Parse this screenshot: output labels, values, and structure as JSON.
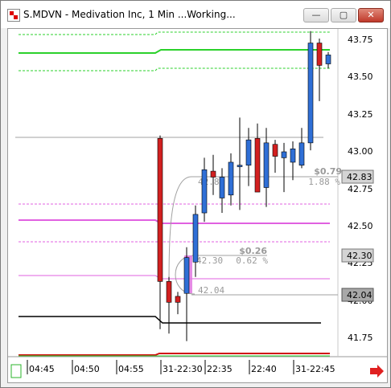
{
  "window": {
    "title": "S.MDVN - Medivation Inc, 1 Min ...Working...",
    "buttons": {
      "minimize": "—",
      "maximize": "▢",
      "close": "✕"
    }
  },
  "price_axis": {
    "ticks": [
      "43.75",
      "43.50",
      "43.25",
      "43.00",
      "42.75",
      "42.50",
      "42.25",
      "42.00",
      "41.75"
    ],
    "markers": [
      {
        "label": "42.83",
        "style": "gray"
      },
      {
        "label": "42.30",
        "style": "gray"
      },
      {
        "label": "42.04",
        "style": "dark"
      }
    ]
  },
  "time_axis": {
    "labels": [
      "04:45",
      "04:50",
      "04:55",
      "31-22:30",
      "22:35",
      "22:40",
      "31-22:45"
    ]
  },
  "annotations": {
    "a1_change": "$0.79",
    "a1_pct": "1.88 %",
    "a1_price": "42.83",
    "a2_change": "$0.26",
    "a2_pct": "0.62 %",
    "a2_price": "42.30",
    "a3_price": "42.04"
  },
  "colors": {
    "up": "#2f6fd6",
    "down": "#d22020",
    "green_line": "#2bd12b",
    "magenta_line": "#e060e0",
    "black_line": "#000000",
    "red_line": "#d01010",
    "scroll_arrow": "#e02020"
  },
  "chart_data": {
    "type": "candlestick",
    "candles": [
      {
        "o": 43.08,
        "h": 43.1,
        "l": 41.8,
        "c": 42.12
      },
      {
        "o": 42.12,
        "h": 42.15,
        "l": 41.77,
        "c": 41.98
      },
      {
        "o": 42.02,
        "h": 42.05,
        "l": 41.9,
        "c": 41.98
      },
      {
        "o": 42.04,
        "h": 42.35,
        "l": 41.72,
        "c": 42.28
      },
      {
        "o": 42.25,
        "h": 42.63,
        "l": 42.15,
        "c": 42.57
      },
      {
        "o": 42.58,
        "h": 42.95,
        "l": 42.52,
        "c": 42.87
      },
      {
        "o": 42.86,
        "h": 42.97,
        "l": 42.7,
        "c": 42.82
      },
      {
        "o": 42.68,
        "h": 42.88,
        "l": 42.58,
        "c": 42.82
      },
      {
        "o": 42.7,
        "h": 42.98,
        "l": 42.63,
        "c": 42.92
      },
      {
        "o": 42.89,
        "h": 43.22,
        "l": 42.6,
        "c": 42.9
      },
      {
        "o": 42.9,
        "h": 43.15,
        "l": 42.76,
        "c": 43.07
      },
      {
        "o": 43.08,
        "h": 43.18,
        "l": 42.75,
        "c": 42.72
      },
      {
        "o": 42.75,
        "h": 43.15,
        "l": 42.62,
        "c": 43.05
      },
      {
        "o": 43.04,
        "h": 43.07,
        "l": 42.85,
        "c": 42.96
      },
      {
        "o": 42.95,
        "h": 43.05,
        "l": 42.72,
        "c": 42.99
      },
      {
        "o": 42.92,
        "h": 43.06,
        "l": 42.8,
        "c": 43.01
      },
      {
        "o": 42.9,
        "h": 43.15,
        "l": 42.88,
        "c": 43.05
      },
      {
        "o": 43.05,
        "h": 43.8,
        "l": 43.0,
        "c": 43.72
      },
      {
        "o": 43.72,
        "h": 43.75,
        "l": 43.33,
        "c": 43.57
      },
      {
        "o": 43.58,
        "h": 43.66,
        "l": 43.55,
        "c": 43.64
      }
    ],
    "ylim": [
      41.62,
      43.83
    ]
  }
}
